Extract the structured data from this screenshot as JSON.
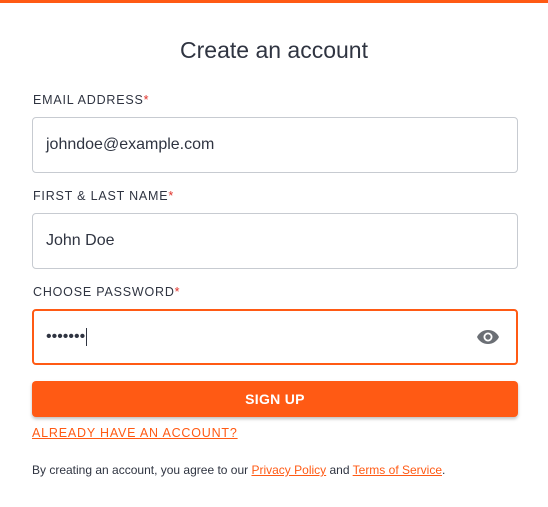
{
  "form": {
    "title": "Create an account",
    "required_mark": "*",
    "email": {
      "label": "EMAIL ADDRESS",
      "value": "johndoe@example.com"
    },
    "name": {
      "label": "FIRST & LAST NAME",
      "value": "John Doe"
    },
    "password": {
      "label": "CHOOSE PASSWORD",
      "value": "•••••••",
      "toggle_icon": "eye-icon"
    },
    "submit_label": "SIGN UP",
    "login_link": "ALREADY HAVE AN ACCOUNT?",
    "terms": {
      "prefix": "By creating an account, you agree to our ",
      "privacy_link": "Privacy Policy",
      "middle": " and ",
      "tos_link": "Terms of Service",
      "suffix": "."
    }
  },
  "colors": {
    "accent": "#ff5a14",
    "text": "#2f3441",
    "required": "#e0322a",
    "border": "#c7cbd1"
  }
}
